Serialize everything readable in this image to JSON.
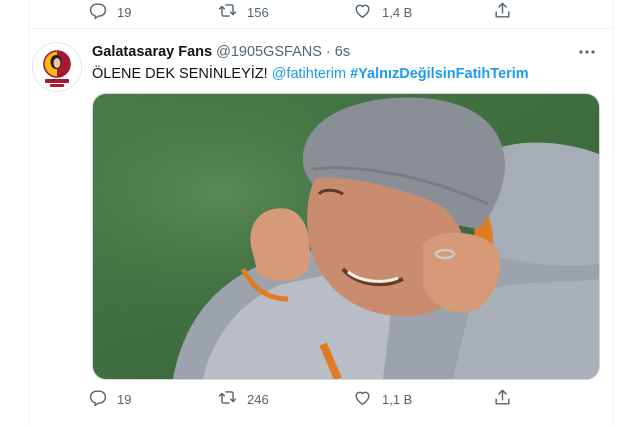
{
  "previous_tweet": {
    "actions": {
      "reply_count": "19",
      "retweet_count": "156",
      "like_count": "1,4 B"
    }
  },
  "tweet": {
    "display_name": "Galatasaray Fans",
    "handle": "@1905GSFANS",
    "separator": "·",
    "time": "6s",
    "text": "ÖLENE DEK SENİNLEYİZ!",
    "mention": "@fatihterim",
    "hashtag": "#YalnızDeğilsinFatihTerim",
    "avatar_logo_text": "GALATASARAY FANS",
    "media_icon": "photo",
    "actions": {
      "reply_count": "19",
      "retweet_count": "246",
      "like_count": "1,1 B"
    }
  },
  "icons": {
    "reply": "speech-bubble",
    "retweet": "retweet-arrows",
    "like": "heart",
    "share": "share-upload",
    "more": "three-dots"
  },
  "colors": {
    "text_primary": "#0f1419",
    "text_secondary": "#536471",
    "link": "#1d9bf0",
    "divider": "#eff3f4",
    "brand_red": "#a6192e",
    "brand_yellow": "#fdb912"
  }
}
